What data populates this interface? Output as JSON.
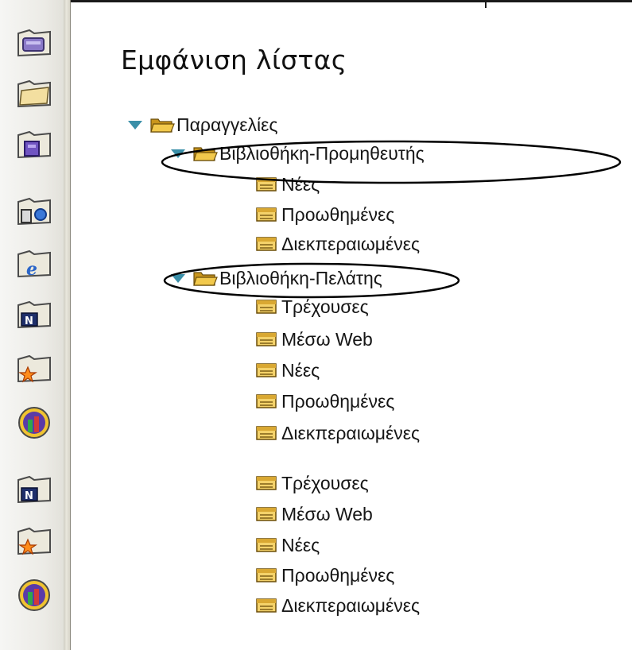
{
  "title": "Εμφάνιση λίστας",
  "sidebar": {
    "items": [
      {
        "icon": "database-folder-icon"
      },
      {
        "icon": "folder-icon"
      },
      {
        "icon": "purple-box-folder-icon"
      },
      {
        "icon": "server-folder-icon"
      },
      {
        "icon": "ie-folder-icon"
      },
      {
        "icon": "notes-folder-icon"
      },
      {
        "icon": "star-folder-icon"
      },
      {
        "icon": "people-globe-icon"
      },
      {
        "icon": "notes-folder-icon"
      },
      {
        "icon": "star-folder-icon"
      },
      {
        "icon": "people-globe-icon"
      }
    ]
  },
  "tree": {
    "root": {
      "label": "Παραγγελίες"
    },
    "supplier": {
      "label": "Βιβλιοθήκη-Προμηθευτής",
      "views": [
        "Νέες",
        "Προωθημένες",
        "Διεκπεραιωμένες"
      ]
    },
    "customer": {
      "label": "Βιβλιοθήκη-Πελάτης",
      "views": [
        "Τρέχουσες",
        "Μέσω Web",
        "Νέες",
        "Προωθημένες",
        "Διεκπεραιωμένες"
      ]
    },
    "extra_views": [
      "Τρέχουσες",
      "Μέσω Web",
      "Νέες",
      "Προωθημένες",
      "Διεκπεραιωμένες"
    ]
  },
  "colors": {
    "folder": "#e9b93a",
    "view_icon": "#d9a832",
    "twisty": "#3a8fa8"
  }
}
